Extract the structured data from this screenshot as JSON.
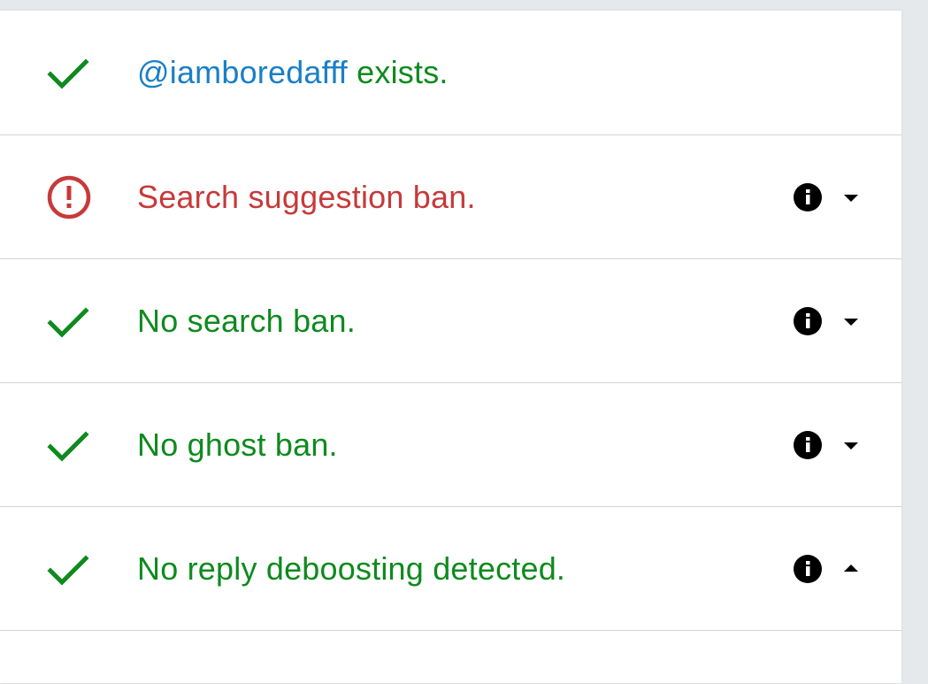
{
  "colors": {
    "ok": "#0e8a1e",
    "bad": "#c63a3a",
    "handle": "#1a7fc6"
  },
  "rows": [
    {
      "status": "ok",
      "status_icon": "check-icon",
      "handle": "@iamboredafff",
      "text": " exists.",
      "has_info": false
    },
    {
      "status": "bad",
      "status_icon": "alert-circle-icon",
      "text": "Search suggestion ban.",
      "has_info": true,
      "expanded": false
    },
    {
      "status": "ok",
      "status_icon": "check-icon",
      "text": "No search ban.",
      "has_info": true,
      "expanded": false
    },
    {
      "status": "ok",
      "status_icon": "check-icon",
      "text": "No ghost ban.",
      "has_info": true,
      "expanded": false
    },
    {
      "status": "ok",
      "status_icon": "check-icon",
      "text": "No reply deboosting detected.",
      "has_info": true,
      "expanded": true
    }
  ]
}
